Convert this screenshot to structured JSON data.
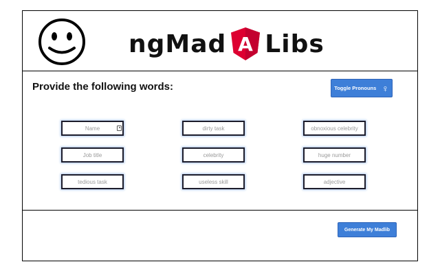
{
  "header": {
    "logo_left": "ngMad",
    "logo_badge": "A",
    "logo_right": "Libs",
    "brand_color": "#c3002f"
  },
  "form": {
    "prompt": "Provide the following words:",
    "toggle_label": "Toggle Pronouns",
    "toggle_icon": "female-venus-icon",
    "fields": [
      {
        "placeholder": "Name"
      },
      {
        "placeholder": "dirty task"
      },
      {
        "placeholder": "obnoxious celebrity"
      },
      {
        "placeholder": "Job title"
      },
      {
        "placeholder": "celebrity"
      },
      {
        "placeholder": "huge number"
      },
      {
        "placeholder": "tedious task"
      },
      {
        "placeholder": "useless skill"
      },
      {
        "placeholder": "adjective"
      }
    ]
  },
  "footer": {
    "generate_label": "Generate My Madlib"
  },
  "colors": {
    "accent": "#3e7fd8"
  }
}
